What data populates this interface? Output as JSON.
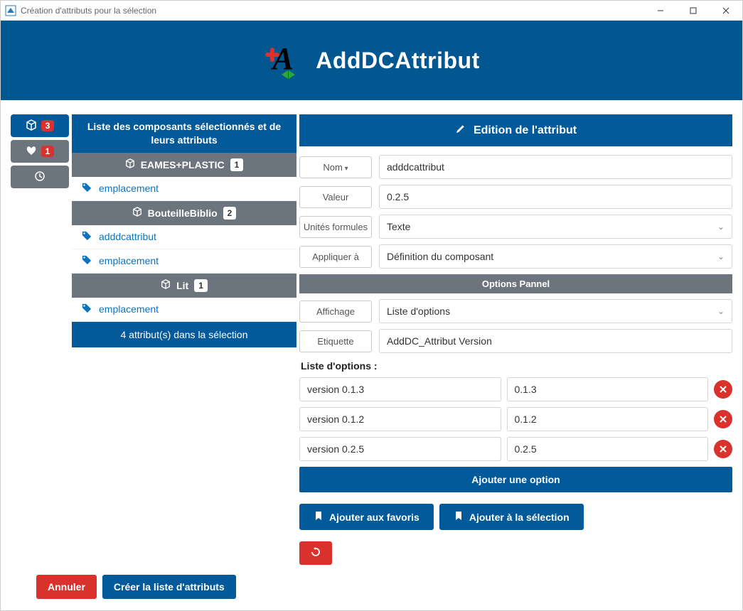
{
  "titlebar": {
    "title": "Création d'attributs pour la sélection"
  },
  "hero": {
    "title": "AddDCAttribut"
  },
  "vtabs": {
    "components_count": "3",
    "favorites_count": "1"
  },
  "componentsPanel": {
    "header": "Liste des composants sélectionnés et de leurs attributs",
    "groups": [
      {
        "name": "EAMES+PLASTIC",
        "count": "1",
        "attrs": [
          "emplacement"
        ]
      },
      {
        "name": "BouteilleBiblio",
        "count": "2",
        "attrs": [
          "adddcattribut",
          "emplacement"
        ]
      },
      {
        "name": "Lit",
        "count": "1",
        "attrs": [
          "emplacement"
        ]
      }
    ],
    "summary": "4 attribut(s) dans la sélection"
  },
  "editor": {
    "header": "Edition de l'attribut",
    "labels": {
      "nom": "Nom",
      "valeur": "Valeur",
      "unites": "Unités formules",
      "appliquer": "Appliquer à",
      "options_panel": "Options Pannel",
      "affichage": "Affichage",
      "etiquette": "Etiquette",
      "options_list_heading": "Liste d'options :"
    },
    "values": {
      "nom": "adddcattribut",
      "valeur": "0.2.5",
      "unites": "Texte",
      "appliquer": "Définition du composant",
      "affichage": "Liste d'options",
      "etiquette": "AddDC_Attribut Version"
    },
    "options": [
      {
        "label": "version 0.1.3",
        "value": "0.1.3"
      },
      {
        "label": "version 0.1.2",
        "value": "0.1.2"
      },
      {
        "label": "version 0.2.5",
        "value": "0.2.5"
      }
    ],
    "add_option": "Ajouter une option",
    "add_favorites": "Ajouter aux favoris",
    "add_selection": "Ajouter à la sélection"
  },
  "footer": {
    "cancel": "Annuler",
    "create": "Créer la liste d'attributs"
  }
}
